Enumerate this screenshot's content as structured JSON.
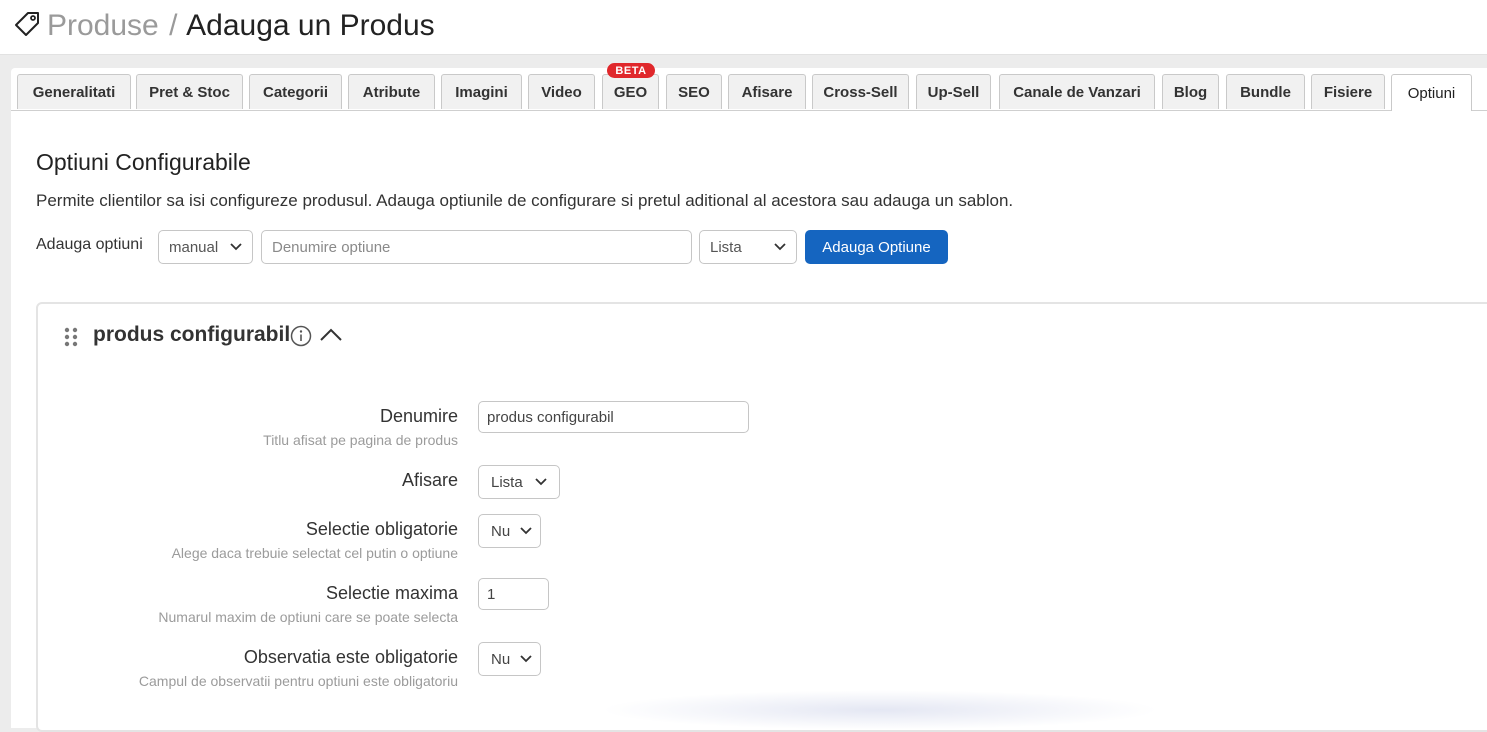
{
  "header": {
    "breadcrumb_parent": "Produse",
    "separator": "/",
    "title": "Adauga un Produs",
    "icon": "tag-icon"
  },
  "tabs": [
    {
      "label": "Generalitati",
      "active": false
    },
    {
      "label": "Pret & Stoc",
      "active": false
    },
    {
      "label": "Categorii",
      "active": false
    },
    {
      "label": "Atribute",
      "active": false
    },
    {
      "label": "Imagini",
      "active": false
    },
    {
      "label": "Video",
      "active": false
    },
    {
      "label": "GEO",
      "active": false,
      "badge": "BETA"
    },
    {
      "label": "SEO",
      "active": false
    },
    {
      "label": "Afisare",
      "active": false
    },
    {
      "label": "Cross-Sell",
      "active": false
    },
    {
      "label": "Up-Sell",
      "active": false
    },
    {
      "label": "Canale de Vanzari",
      "active": false
    },
    {
      "label": "Blog",
      "active": false
    },
    {
      "label": "Bundle",
      "active": false
    },
    {
      "label": "Fisiere",
      "active": false
    },
    {
      "label": "Optiuni",
      "active": true
    }
  ],
  "section": {
    "title": "Optiuni Configurabile",
    "description": "Permite clientilor sa isi configureze produsul. Adauga optiunile de configurare si pretul aditional al acestora sau adauga un sablon."
  },
  "add_row": {
    "label": "Adauga optiuni",
    "mode_value": "manual",
    "name_placeholder": "Denumire optiune",
    "type_value": "Lista",
    "button_label": "Adauga Optiune"
  },
  "option_card": {
    "title": "produs configurabil",
    "fields": {
      "name": {
        "label": "Denumire",
        "help": "Titlu afisat pe pagina de produs",
        "value": "produs configurabil"
      },
      "display": {
        "label": "Afisare",
        "value": "Lista"
      },
      "required": {
        "label": "Selectie obligatorie",
        "help": "Alege daca trebuie selectat cel putin o optiune",
        "value": "Nu"
      },
      "max": {
        "label": "Selectie maxima",
        "help": "Numarul maxim de optiuni care se poate selecta",
        "value": "1"
      },
      "note_required": {
        "label": "Observatia este obligatorie",
        "help": "Campul de observatii pentru optiuni este obligatoriu",
        "value": "Nu"
      }
    }
  },
  "colors": {
    "primary_button": "#1565c0",
    "beta_badge": "#e0272b"
  }
}
